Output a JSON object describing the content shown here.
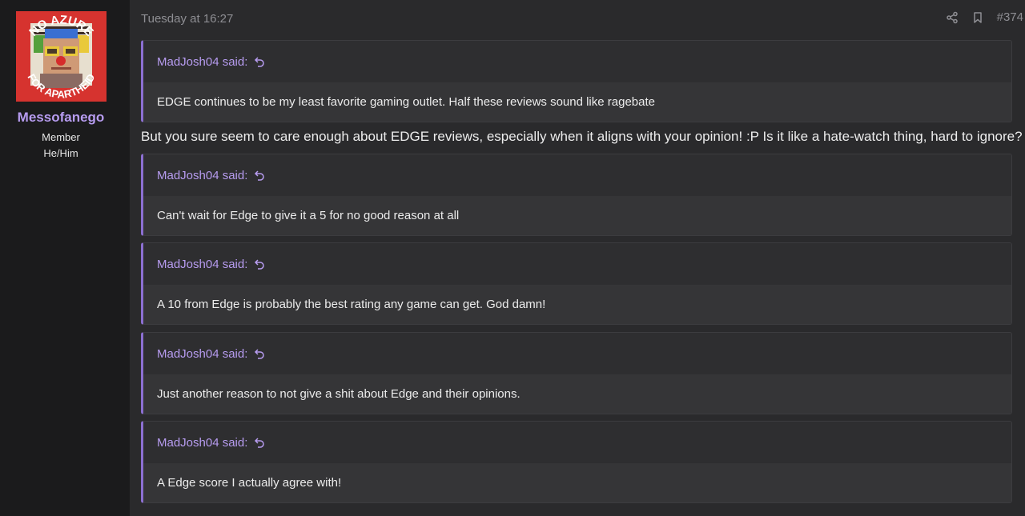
{
  "user": {
    "name": "Messofanego",
    "title": "Member",
    "pronouns": "He/Him",
    "avatar": {
      "top_text": "NO AZURE",
      "bottom_text": "FOR APARTHEID",
      "bg_color": "#d6332f"
    }
  },
  "post": {
    "timestamp": "Tuesday at 16:27",
    "number": "#374",
    "actions": [
      {
        "icon": "share-icon"
      },
      {
        "icon": "bookmark-icon"
      }
    ],
    "accent_color": "#8c6fd1",
    "username_color": "#b79cf0",
    "reply_text": "But you sure seem to care enough about EDGE reviews, especially when it aligns with your opinion! :P Is it like a hate-watch thing, hard to ignore?",
    "quotes": [
      {
        "author": "MadJosh04 said:",
        "text": "EDGE continues to be my least favorite gaming outlet. Half these reviews sound like ragebate"
      },
      {
        "author": "MadJosh04 said:",
        "text": "Can't wait for Edge to give it a 5 for no good reason at all"
      },
      {
        "author": "MadJosh04 said:",
        "text": "A 10 from Edge is probably the best rating any game can get. God damn!"
      },
      {
        "author": "MadJosh04 said:",
        "text": "Just another reason to not give a shit about Edge and their opinions."
      },
      {
        "author": "MadJosh04 said:",
        "text": "A Edge score I actually agree with!"
      }
    ]
  }
}
